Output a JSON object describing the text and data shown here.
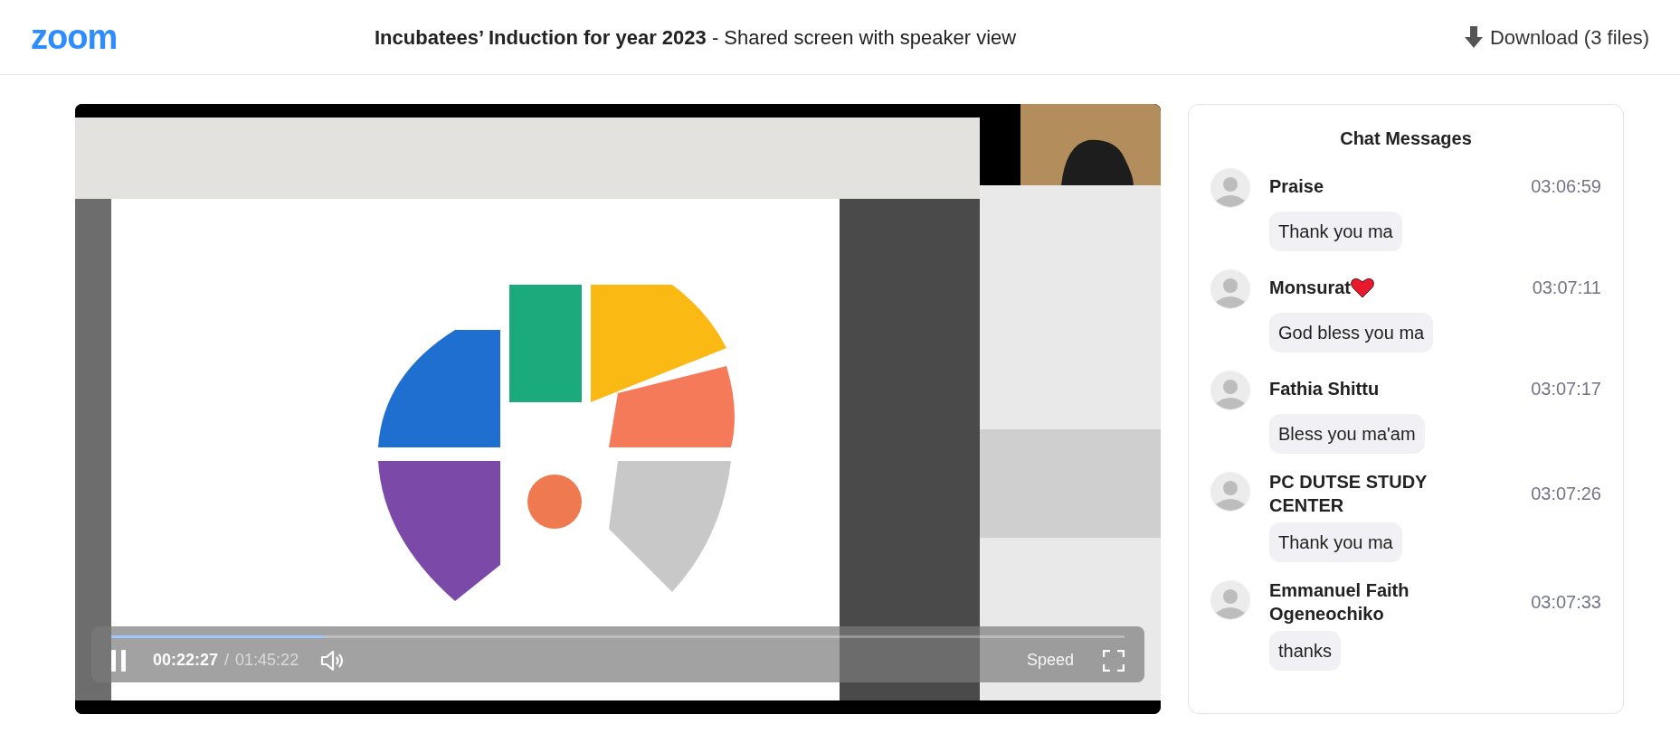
{
  "header": {
    "logo": "zoom",
    "title": "**Incubatees’ Induction for year 2023** - Shared screen with speaker view",
    "download": "Download (3 files)"
  },
  "player": {
    "playing": true,
    "level": 0.21,
    "elapsed": "00:22:27",
    "separator": "/",
    "duration": "01:45:22",
    "speed": "Speed"
  },
  "chat": {
    "title": "Chat Messages",
    "messages": [
      {
        "name": "Praise",
        "heart": false,
        "time": "03:06:59",
        "text": "Thank you ma"
      },
      {
        "name": "Monsurat",
        "heart": true,
        "time": "03:07:11",
        "text": "God bless you ma"
      },
      {
        "name": "Fathia Shittu",
        "heart": false,
        "time": "03:07:17",
        "text": "Bless you ma'am"
      },
      {
        "name": "PC DUTSE STUDY CENTER",
        "heart": false,
        "time": "03:07:26",
        "text": "Thank you ma"
      },
      {
        "name": "Emmanuel Faith Ogeneochiko",
        "heart": false,
        "time": "03:07:33",
        "text": "thanks"
      }
    ]
  }
}
